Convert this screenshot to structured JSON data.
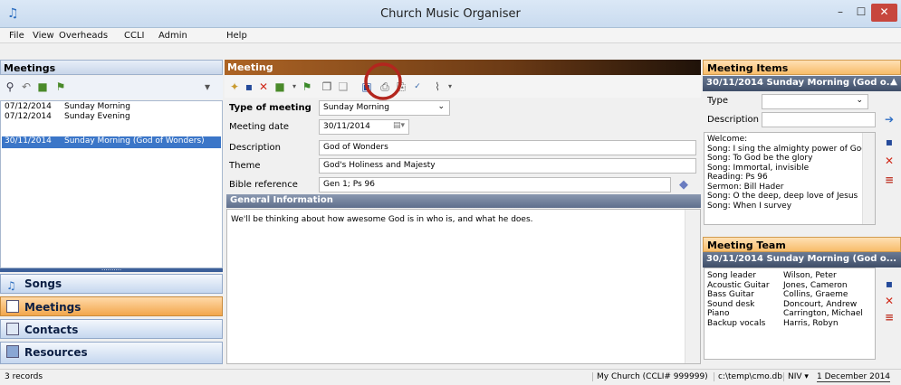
{
  "window": {
    "title": "Church Music Organiser",
    "minimize": "–",
    "maximize": "☐",
    "close": "✕"
  },
  "menu": [
    "File",
    "View",
    "Overheads",
    "CCLI",
    "Admin",
    "Help"
  ],
  "meetings_panel": {
    "title": "Meetings",
    "rows": [
      {
        "date": "07/12/2014",
        "name": "Sunday Morning"
      },
      {
        "date": "07/12/2014",
        "name": "Sunday Evening"
      },
      {
        "date": "30/11/2014",
        "name": "Sunday Morning (God of Wonders)"
      }
    ],
    "grip": "..........",
    "nav": [
      "Songs",
      "Meetings",
      "Contacts",
      "Resources"
    ]
  },
  "meeting": {
    "title": "Meeting",
    "type_label": "Type of meeting",
    "type_value": "Sunday Morning",
    "date_label": "Meeting date",
    "date_value": "30/11/2014",
    "description_label": "Description",
    "description_value": "God of Wonders",
    "theme_label": "Theme",
    "theme_value": "God's Holiness and Majesty",
    "bible_label": "Bible reference",
    "bible_value": "Gen 1; Ps 96",
    "general_title": "General Information",
    "general_text": "We'll be thinking about how awesome God is in who is, and what he does."
  },
  "meeting_items": {
    "title": "Meeting Items",
    "subtitle": "30/11/2014 Sunday Morning (God o...",
    "type_label": "Type",
    "type_value": "",
    "description_label": "Description",
    "description_value": "",
    "items": [
      "Welcome:",
      "Song: I sing the almighty power of God",
      "Song: To God be the glory",
      "Song: Immortal, invisible",
      "Reading: Ps 96",
      "Sermon: Bill Hader",
      "Song: O the deep, deep love of Jesus",
      "Song: When I survey"
    ]
  },
  "meeting_team": {
    "title": "Meeting Team",
    "subtitle": "30/11/2014 Sunday Morning (God o...",
    "members": [
      {
        "role": "Song leader",
        "name": "Wilson, Peter"
      },
      {
        "role": "Acoustic Guitar",
        "name": "Jones, Cameron"
      },
      {
        "role": "Bass Guitar",
        "name": "Collins, Graeme"
      },
      {
        "role": "Sound desk",
        "name": "Doncourt, Andrew"
      },
      {
        "role": "Piano",
        "name": "Carrington, Michael"
      },
      {
        "role": "Backup vocals",
        "name": "Harris, Robyn"
      }
    ]
  },
  "status": {
    "records": "3 records",
    "church": "My Church (CCLI# 999999)",
    "db": "c:\\temp\\cmo.db",
    "bible": "NIV",
    "date": "1 December 2014"
  },
  "colors": {
    "accent": "#3b76c8",
    "active_nav": "#f2a64c",
    "highlight_circle": "#b3261e"
  }
}
